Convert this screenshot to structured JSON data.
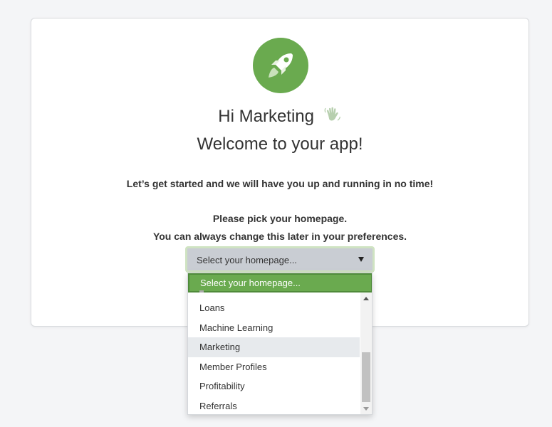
{
  "greeting": "Hi Marketing",
  "welcome": "Welcome to your app!",
  "lead": "Let’s get started and we will have you up and running in no time!",
  "pick_homepage": "Please pick your homepage.",
  "change_later": "You can always change this later in your preferences.",
  "select": {
    "value": "Select your homepage...",
    "highlighted_option": "Select your homepage...",
    "options": [
      "Loans",
      "Machine Learning",
      "Marketing",
      "Member Profiles",
      "Profitability",
      "Referrals"
    ],
    "hovered_option": "Marketing"
  },
  "icons": {
    "logo": "rocket-icon",
    "greeting_emoji": "waving-hand-icon"
  },
  "colors": {
    "brand_green": "#6aaa4f",
    "select_bg": "#c9cdd3",
    "hover_bg": "#e7eaed"
  }
}
